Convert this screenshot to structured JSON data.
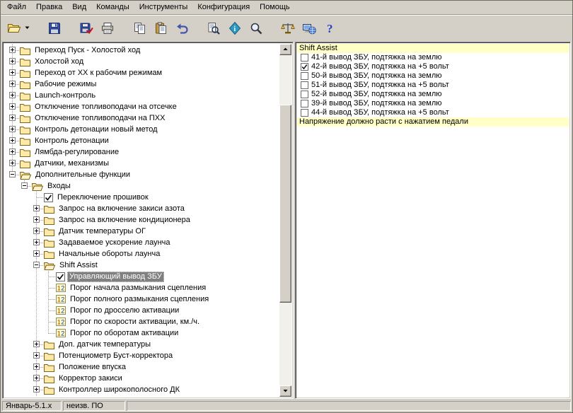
{
  "colors": {
    "window_face": "#d4d0c8",
    "highlight_yellow": "#ffffc6",
    "inactive_selection": "#808080",
    "tree_background": "#ffffff"
  },
  "menu": {
    "items": [
      {
        "id": "file",
        "label": "Файл"
      },
      {
        "id": "edit",
        "label": "Правка"
      },
      {
        "id": "view",
        "label": "Вид"
      },
      {
        "id": "commands",
        "label": "Команды"
      },
      {
        "id": "instruments",
        "label": "Инструменты"
      },
      {
        "id": "configuration",
        "label": "Конфигурация"
      },
      {
        "id": "help",
        "label": "Помощь"
      }
    ]
  },
  "toolbar": {
    "buttons": [
      {
        "name": "open",
        "icon": "open-folder-icon"
      },
      {
        "name": "open-dropdown",
        "icon": "dropdown-arrow-icon",
        "narrow": true
      },
      {
        "name": "save",
        "icon": "save-icon",
        "gap": true
      },
      {
        "name": "save-as",
        "icon": "save-as-icon",
        "gap": true
      },
      {
        "name": "print",
        "icon": "print-icon"
      },
      {
        "name": "copy",
        "icon": "copy-icon",
        "gap": true
      },
      {
        "name": "paste",
        "icon": "paste-icon"
      },
      {
        "name": "undo",
        "icon": "undo-icon"
      },
      {
        "name": "preview",
        "icon": "preview-icon",
        "gap": true
      },
      {
        "name": "info",
        "icon": "info-icon"
      },
      {
        "name": "search",
        "icon": "search-icon"
      },
      {
        "name": "tools",
        "icon": "tools-icon",
        "gap": true
      },
      {
        "name": "network",
        "icon": "network-icon"
      },
      {
        "name": "help",
        "icon": "help-icon"
      }
    ]
  },
  "tree": {
    "items": [
      {
        "level": 0,
        "expander": "plus",
        "icon": "folder-icon",
        "label": "Переход Пуск - Холостой ход"
      },
      {
        "level": 0,
        "expander": "plus",
        "icon": "folder-icon",
        "label": "Холостой ход"
      },
      {
        "level": 0,
        "expander": "plus",
        "icon": "folder-icon",
        "label": "Переход от ХХ к рабочим режимам"
      },
      {
        "level": 0,
        "expander": "plus",
        "icon": "folder-icon",
        "label": "Рабочие режимы"
      },
      {
        "level": 0,
        "expander": "plus",
        "icon": "folder-icon",
        "label": "Launch-контроль"
      },
      {
        "level": 0,
        "expander": "plus",
        "icon": "folder-icon",
        "label": "Отключение топливоподачи на отсечке"
      },
      {
        "level": 0,
        "expander": "plus",
        "icon": "folder-icon",
        "label": "Отключение топливоподачи на ПХХ"
      },
      {
        "level": 0,
        "expander": "plus",
        "icon": "folder-icon",
        "label": "Контроль детонации новый метод"
      },
      {
        "level": 0,
        "expander": "plus",
        "icon": "folder-icon",
        "label": "Контроль детонации"
      },
      {
        "level": 0,
        "expander": "plus",
        "icon": "folder-icon",
        "label": "Лямбда-регулирование"
      },
      {
        "level": 0,
        "expander": "plus",
        "icon": "folder-icon",
        "label": "Датчики, механизмы"
      },
      {
        "level": 0,
        "expander": "minus",
        "icon": "folder-open-icon",
        "label": "Дополнительные функции"
      },
      {
        "level": 1,
        "expander": "minus",
        "icon": "folder-open-icon",
        "label": "Входы"
      },
      {
        "level": 2,
        "expander": null,
        "icon": "checkbox-checked-icon",
        "label": "Переключение прошивок"
      },
      {
        "level": 2,
        "expander": "plus",
        "icon": "folder-icon",
        "label": "Запрос на включение закиси азота"
      },
      {
        "level": 2,
        "expander": "plus",
        "icon": "folder-icon",
        "label": "Запрос на включение кондиционера"
      },
      {
        "level": 2,
        "expander": "plus",
        "icon": "folder-icon",
        "label": "Датчик температуры ОГ"
      },
      {
        "level": 2,
        "expander": "plus",
        "icon": "folder-icon",
        "label": "Задаваемое ускорение лаунча"
      },
      {
        "level": 2,
        "expander": "plus",
        "icon": "folder-icon",
        "label": "Начальные обороты лаунча"
      },
      {
        "level": 2,
        "expander": "minus",
        "icon": "folder-open-icon",
        "label": "Shift Assist"
      },
      {
        "level": 3,
        "expander": null,
        "icon": "checkbox-checked-icon",
        "label": "Управляющий вывод ЗБУ",
        "selected": true
      },
      {
        "level": 3,
        "expander": null,
        "icon": "param-12-icon",
        "label": "Порог начала размыкания сцепления"
      },
      {
        "level": 3,
        "expander": null,
        "icon": "param-12-icon",
        "label": "Порог полного размыкания сцепления"
      },
      {
        "level": 3,
        "expander": null,
        "icon": "param-12-icon",
        "label": "Порог по дросселю активации"
      },
      {
        "level": 3,
        "expander": null,
        "icon": "param-12-icon",
        "label": "Порог по скорости активации, км./ч."
      },
      {
        "level": 3,
        "expander": null,
        "icon": "param-12-icon",
        "label": "Порог по оборотам активации"
      },
      {
        "level": 2,
        "expander": "plus",
        "icon": "folder-icon",
        "label": "Доп. датчик температуры"
      },
      {
        "level": 2,
        "expander": "plus",
        "icon": "folder-icon",
        "label": "Потенциометр Буст-корректора"
      },
      {
        "level": 2,
        "expander": "plus",
        "icon": "folder-icon",
        "label": "Положение впуска"
      },
      {
        "level": 2,
        "expander": "plus",
        "icon": "folder-icon",
        "label": "Корректор закиси"
      },
      {
        "level": 2,
        "expander": "plus",
        "icon": "folder-icon",
        "label": "Контроллер широкополосного ДК"
      },
      {
        "level": 2,
        "expander": "plus",
        "icon": "folder-icon",
        "label": ""
      }
    ]
  },
  "panel": {
    "header": "Shift Assist",
    "options": [
      {
        "label": "41-й вывод ЗБУ, подтяжка на землю",
        "checked": false
      },
      {
        "label": "42-й вывод ЗБУ, подтяжка на +5 вольт",
        "checked": true
      },
      {
        "label": "50-й вывод ЗБУ, подтяжка на землю",
        "checked": false
      },
      {
        "label": "51-й вывод ЗБУ, подтяжка на +5 вольт",
        "checked": false
      },
      {
        "label": "52-й вывод ЗБУ, подтяжка на землю",
        "checked": false
      },
      {
        "label": "39-й вывод ЗБУ, подтяжка на землю",
        "checked": false
      },
      {
        "label": "44-й вывод ЗБУ, подтяжка на +5 вольт",
        "checked": false
      }
    ],
    "note": "Напряжение должно расти с нажатием педали"
  },
  "statusbar": {
    "left": "Январь-5.1.x",
    "center": "неизв. ПО"
  }
}
